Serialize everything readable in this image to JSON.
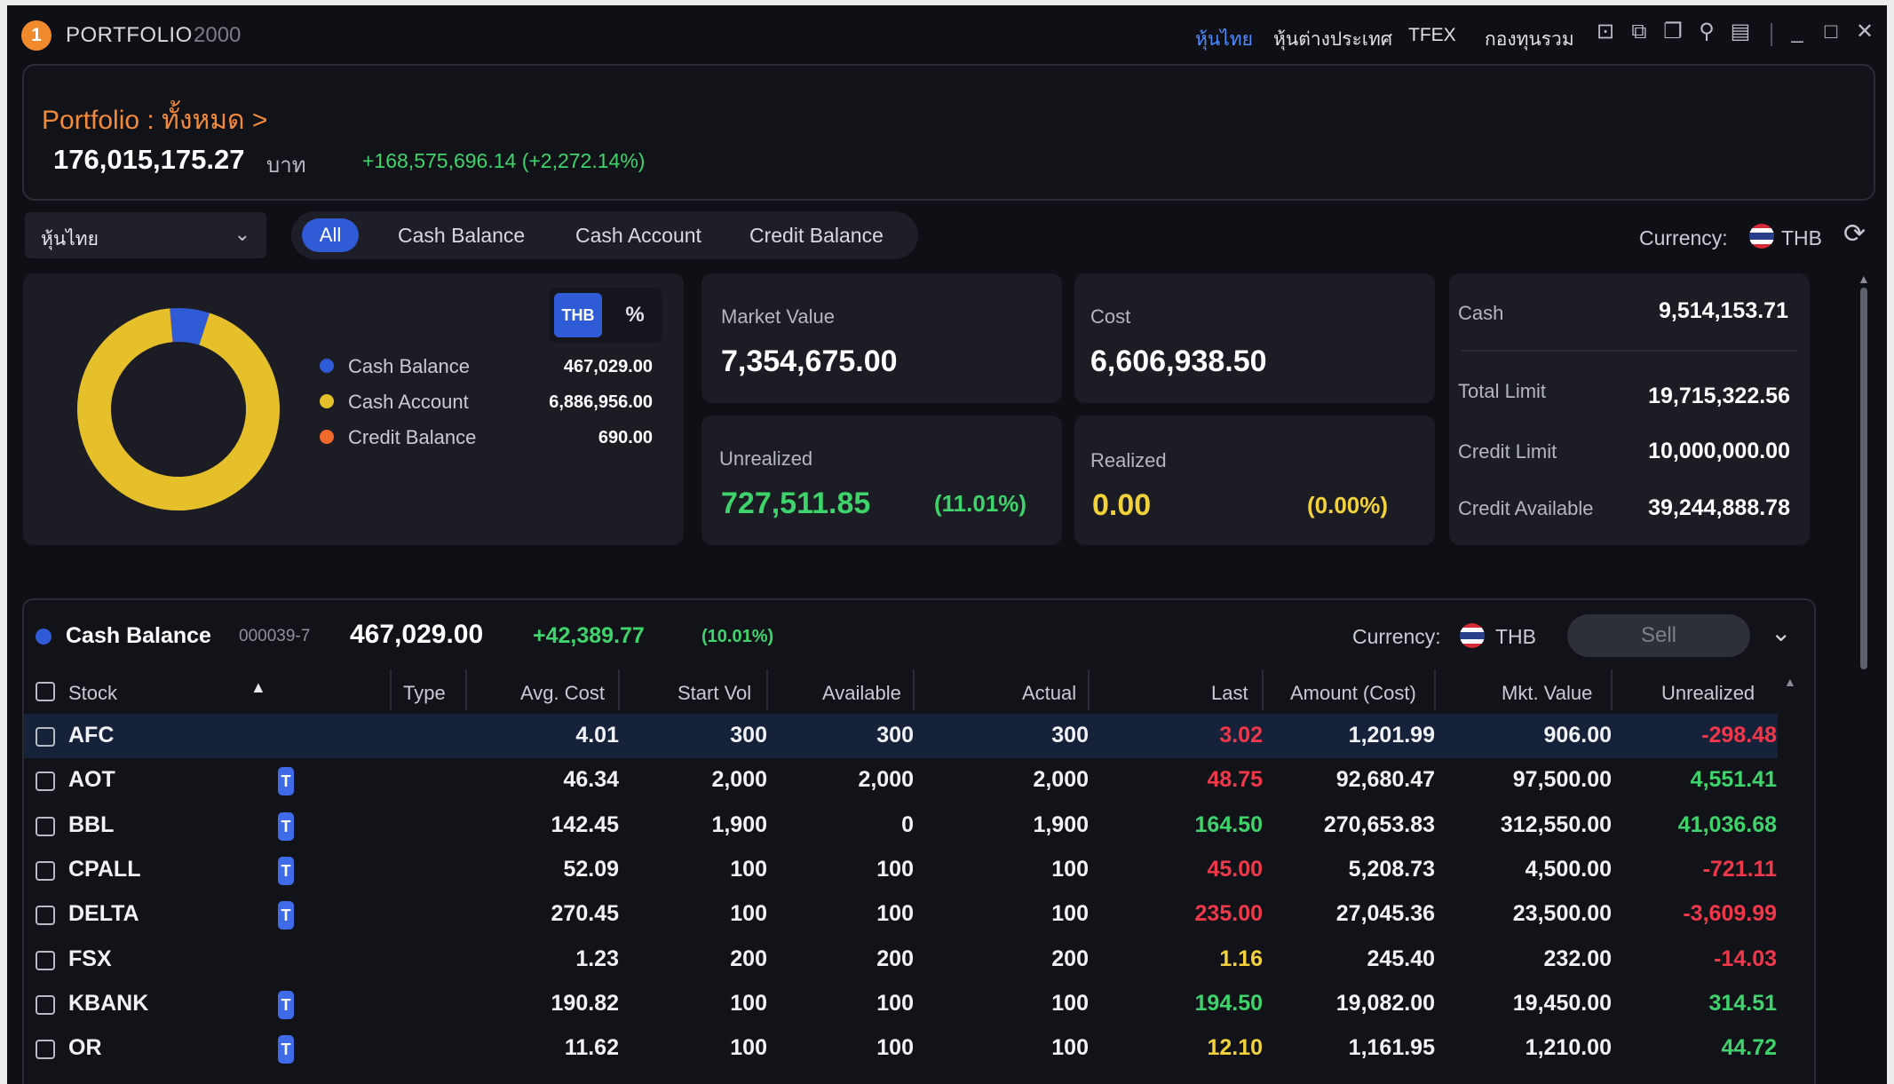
{
  "window": {
    "badge": "1",
    "title": "PORTFOLIO",
    "code": "2000",
    "nav": [
      "หุ้นไทย",
      "หุ้นต่างประเทศ",
      "TFEX",
      "กองทุนรวม"
    ],
    "icons": [
      "template-icon",
      "external-icon",
      "copy-icon",
      "pin-icon",
      "book-icon",
      "minimize-icon",
      "maximize-icon",
      "close-icon"
    ]
  },
  "portfolio": {
    "title": "Portfolio : ทั้งหมด >",
    "total": "176,015,175.27",
    "unit": "บาท",
    "gain": "+168,575,696.14 (+2,272.14%)"
  },
  "filters": {
    "market": "หุ้นไทย",
    "tabs": [
      "All",
      "Cash Balance",
      "Cash Account",
      "Credit Balance"
    ],
    "currency_label": "Currency:",
    "currency": "THB"
  },
  "breakdown": {
    "toggle_thb": "THB",
    "toggle_pct": "%",
    "items": [
      {
        "name": "Cash Balance",
        "value": "467,029.00",
        "color": "#2f5bd6",
        "share": 0.0635
      },
      {
        "name": "Cash Account",
        "value": "6,886,956.00",
        "color": "#e6c02a",
        "share": 0.9364
      },
      {
        "name": "Credit Balance",
        "value": "690.00",
        "color": "#f0692a",
        "share": 0.0001
      }
    ]
  },
  "summary": {
    "market_value_label": "Market Value",
    "market_value": "7,354,675.00",
    "cost_label": "Cost",
    "cost": "6,606,938.50",
    "unrealized_label": "Unrealized",
    "unrealized": "727,511.85",
    "unrealized_pct": "(11.01%)",
    "realized_label": "Realized",
    "realized": "0.00",
    "realized_pct": "(0.00%)"
  },
  "credit": {
    "cash_label": "Cash",
    "cash": "9,514,153.71",
    "total_limit_label": "Total Limit",
    "total_limit": "19,715,322.56",
    "credit_limit_label": "Credit Limit",
    "credit_limit": "10,000,000.00",
    "credit_available_label": "Credit Available",
    "credit_available": "39,244,888.78"
  },
  "account": {
    "name": "Cash Balance",
    "number": "000039-7",
    "value": "467,029.00",
    "change": "+42,389.77",
    "change_pct": "(10.01%)",
    "currency_label": "Currency:",
    "currency": "THB",
    "sell_label": "Sell"
  },
  "table": {
    "columns": [
      "Stock",
      "Type",
      "Avg. Cost",
      "Start Vol",
      "Available",
      "Actual",
      "Last",
      "Amount (Cost)",
      "Mkt. Value",
      "Unrealized"
    ],
    "rows": [
      {
        "stock": "AFC",
        "t": "",
        "avg": "4.01",
        "start": "300",
        "avail": "300",
        "actual": "300",
        "last": "3.02",
        "last_color": "#f0384a",
        "amount": "1,201.99",
        "mkt": "906.00",
        "unreal": "-298.48",
        "unreal_color": "#f0384a"
      },
      {
        "stock": "AOT",
        "t": "T",
        "avg": "46.34",
        "start": "2,000",
        "avail": "2,000",
        "actual": "2,000",
        "last": "48.75",
        "last_color": "#f0384a",
        "amount": "92,680.47",
        "mkt": "97,500.00",
        "unreal": "4,551.41",
        "unreal_color": "#3fd36b"
      },
      {
        "stock": "BBL",
        "t": "T",
        "avg": "142.45",
        "start": "1,900",
        "avail": "0",
        "actual": "1,900",
        "last": "164.50",
        "last_color": "#3fd36b",
        "amount": "270,653.83",
        "mkt": "312,550.00",
        "unreal": "41,036.68",
        "unreal_color": "#3fd36b"
      },
      {
        "stock": "CPALL",
        "t": "T",
        "avg": "52.09",
        "start": "100",
        "avail": "100",
        "actual": "100",
        "last": "45.00",
        "last_color": "#f0384a",
        "amount": "5,208.73",
        "mkt": "4,500.00",
        "unreal": "-721.11",
        "unreal_color": "#f0384a"
      },
      {
        "stock": "DELTA",
        "t": "T",
        "avg": "270.45",
        "start": "100",
        "avail": "100",
        "actual": "100",
        "last": "235.00",
        "last_color": "#f0384a",
        "amount": "27,045.36",
        "mkt": "23,500.00",
        "unreal": "-3,609.99",
        "unreal_color": "#f0384a"
      },
      {
        "stock": "FSX",
        "t": "",
        "avg": "1.23",
        "start": "200",
        "avail": "200",
        "actual": "200",
        "last": "1.16",
        "last_color": "#f2d23a",
        "amount": "245.40",
        "mkt": "232.00",
        "unreal": "-14.03",
        "unreal_color": "#f0384a"
      },
      {
        "stock": "KBANK",
        "t": "T",
        "avg": "190.82",
        "start": "100",
        "avail": "100",
        "actual": "100",
        "last": "194.50",
        "last_color": "#3fd36b",
        "amount": "19,082.00",
        "mkt": "19,450.00",
        "unreal": "314.51",
        "unreal_color": "#3fd36b"
      },
      {
        "stock": "OR",
        "t": "T",
        "avg": "11.62",
        "start": "100",
        "avail": "100",
        "actual": "100",
        "last": "12.10",
        "last_color": "#f2d23a",
        "amount": "1,161.95",
        "mkt": "1,210.00",
        "unreal": "44.72",
        "unreal_color": "#3fd36b"
      }
    ]
  }
}
